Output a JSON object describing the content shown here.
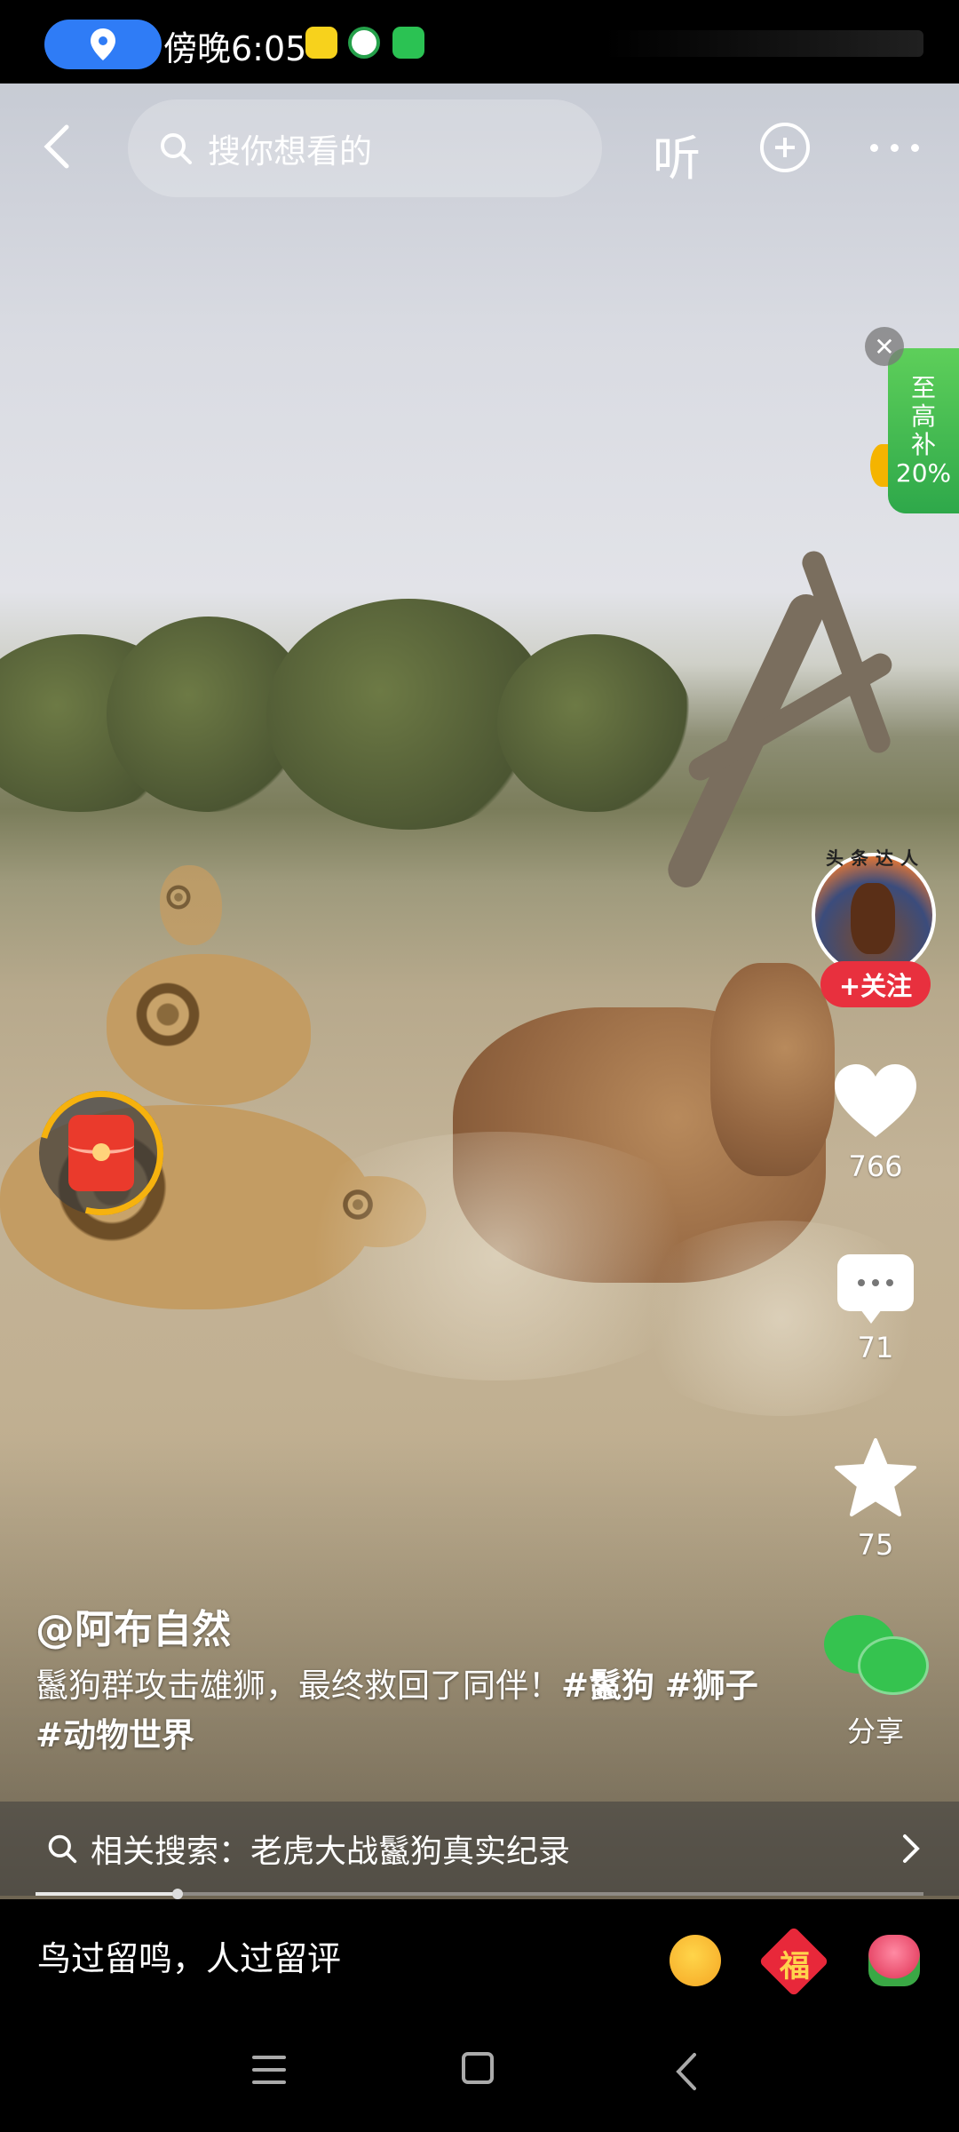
{
  "status_bar": {
    "time": "傍晚6:05",
    "location_icon": "location-pin-icon"
  },
  "top_bar": {
    "search_placeholder": "搜你想看的",
    "listen_label": "听"
  },
  "promo": {
    "lines": [
      "至",
      "高",
      "补",
      "20%"
    ]
  },
  "author_rail": {
    "avatar_text": "头条达人",
    "follow_label": "+关注",
    "likes": "766",
    "comments": "71",
    "favorites": "75",
    "share_label": "分享"
  },
  "caption": {
    "author": "@阿布自然",
    "text": "鬣狗群攻击雄狮，最终救回了同伴！",
    "tag1": "#鬣狗",
    "tag2": "#狮子",
    "tag3": "#动物世界"
  },
  "related_search": {
    "label": "相关搜索：老虎大战鬣狗真实纪录"
  },
  "progress": {
    "fraction": 0.16
  },
  "comment_bar": {
    "placeholder": "鸟过留鸣，人过留评",
    "fu_text": "福"
  },
  "colors": {
    "follow": "#e8303e",
    "share": "#35c34f",
    "promo": "#2ea84a",
    "location_pill": "#2f7cf6"
  }
}
